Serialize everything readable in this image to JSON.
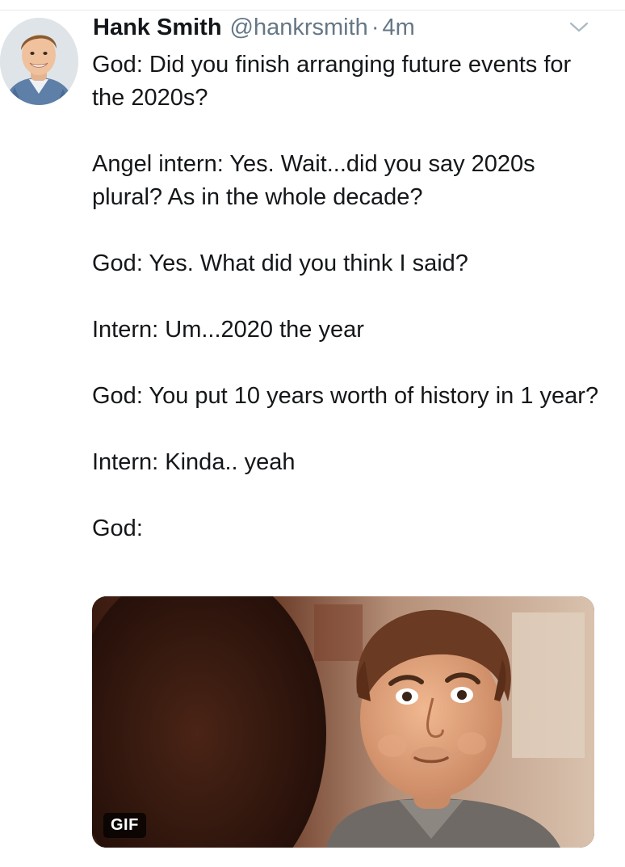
{
  "tweet": {
    "author": {
      "display_name": "Hank Smith",
      "handle": "@hankrsmith",
      "separator": "·",
      "time": "4m"
    },
    "paragraphs": [
      "God: Did you finish arranging future events for the 2020s?",
      "Angel intern: Yes. Wait...did you say 2020s plural? As in the whole decade?",
      "God: Yes. What did you think I said?",
      "Intern: Um...2020 the year",
      "God: You put 10 years worth of history in 1 year?",
      "Intern: Kinda.. yeah",
      "God:"
    ],
    "media": {
      "badge": "GIF"
    },
    "icons": {
      "menu": "chevron-down-icon",
      "avatar": "avatar"
    },
    "colors": {
      "text": "#14171a",
      "secondary": "#657786",
      "divider": "#e6ecf0"
    }
  }
}
